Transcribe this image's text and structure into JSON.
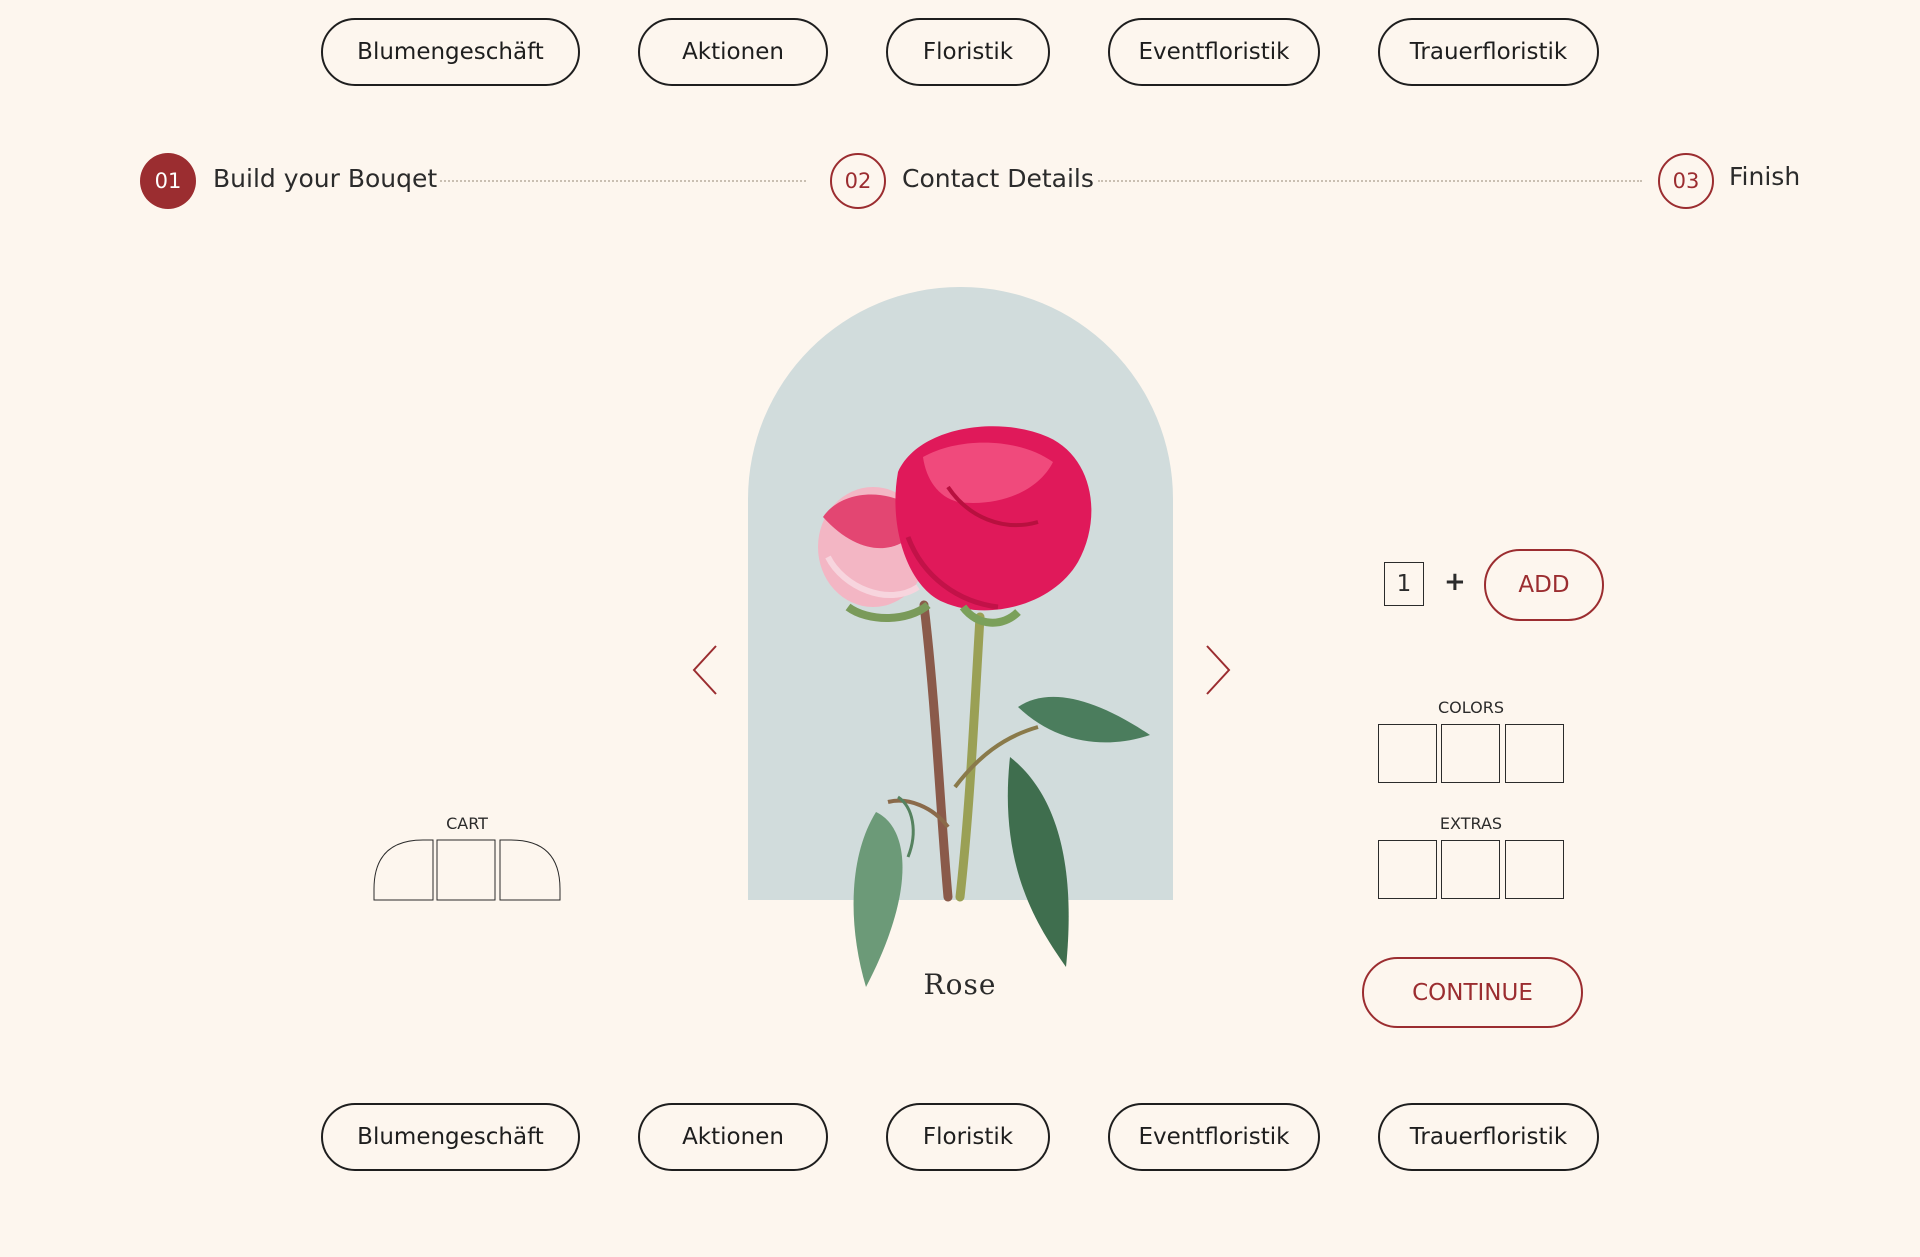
{
  "nav_top": [
    "Blumengeschäft",
    "Aktionen",
    "Floristik",
    "Eventfloristik",
    "Trauerfloristik"
  ],
  "nav_bottom": [
    "Blumengeschäft",
    "Aktionen",
    "Floristik",
    "Eventfloristik",
    "Trauerfloristik"
  ],
  "steps": [
    {
      "number": "01",
      "label": "Build your Bouqet"
    },
    {
      "number": "02",
      "label": "Contact Details"
    },
    {
      "number": "03",
      "label": "Finish"
    }
  ],
  "product": {
    "name": "Rose"
  },
  "quantity": "1",
  "plus_label": "+",
  "add_label": "ADD",
  "colors_label": "COLORS",
  "extras_label": "EXTRAS",
  "cart_label": "CART",
  "continue_label": "CONTINUE",
  "colors": {
    "background": "#fdf6ee",
    "accent": "#9b2d30",
    "arch": "#d1dcdc"
  }
}
